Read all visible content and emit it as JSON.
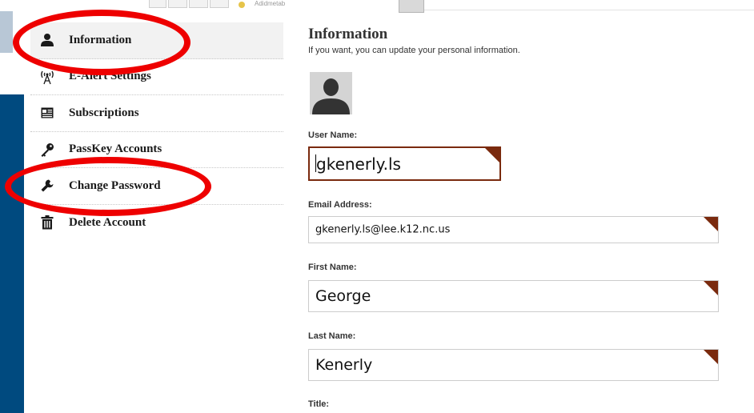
{
  "top_strip": {
    "partial_text": "Adidmetab"
  },
  "sidebar": {
    "items": [
      {
        "label": "Information",
        "icon": "person-icon",
        "active": true
      },
      {
        "label": "E-Alert Settings",
        "icon": "antenna-icon",
        "active": false
      },
      {
        "label": "Subscriptions",
        "icon": "newspaper-icon",
        "active": false
      },
      {
        "label": "PassKey Accounts",
        "icon": "key-icon",
        "active": false
      },
      {
        "label": "Change Password",
        "icon": "wrench-icon",
        "active": false
      },
      {
        "label": "Delete Account",
        "icon": "trash-icon",
        "active": false
      }
    ]
  },
  "main": {
    "title": "Information",
    "subtitle": "If you want, you can update your personal information.",
    "fields": {
      "username": {
        "label": "User Name:",
        "value": "gkenerly.ls"
      },
      "email": {
        "label": "Email Address:",
        "value": "gkenerly.ls@lee.k12.nc.us"
      },
      "first_name": {
        "label": "First Name:",
        "value": "George"
      },
      "last_name": {
        "label": "Last Name:",
        "value": "Kenerly"
      },
      "title": {
        "label": "Title:"
      }
    }
  },
  "colors": {
    "accent_dark_red": "#7a2a0e",
    "annotation_red": "#ee0000",
    "edge_blue": "#004a7f"
  }
}
